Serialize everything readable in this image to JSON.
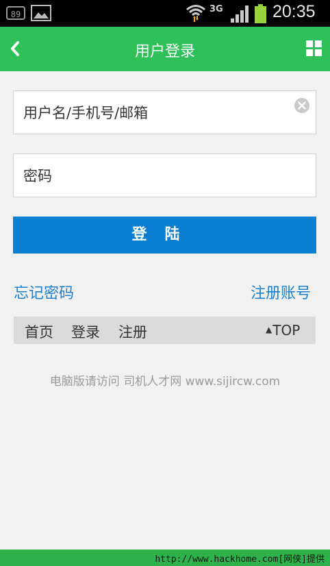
{
  "status_bar": {
    "badge": "89",
    "network": "3G",
    "time": "20:35",
    "icons": [
      "notification-count-icon",
      "gallery-icon",
      "wifi-icon",
      "signal-icon",
      "battery-icon"
    ]
  },
  "header": {
    "title": "用户登录",
    "back_icon": "chevron-left-icon",
    "menu_icon": "grid-icon",
    "color": "#2fc05a"
  },
  "form": {
    "username_placeholder": "用户名/手机号/邮箱",
    "username_value": "",
    "password_placeholder": "密码",
    "password_value": "",
    "login_label": "登陆",
    "forgot_label": "忘记密码",
    "register_label": "注册账号"
  },
  "nav": {
    "items": [
      "首页",
      "登录",
      "注册"
    ],
    "top_label": "TOP"
  },
  "footer": {
    "note": "电脑版请访问 司机人才网 www.sijircw.com",
    "watermark": "http://www.hackhome.com[网侠]提供"
  },
  "colors": {
    "accent": "#2fc05a",
    "button": "#0a7fd1",
    "link": "#1b7ecf"
  }
}
